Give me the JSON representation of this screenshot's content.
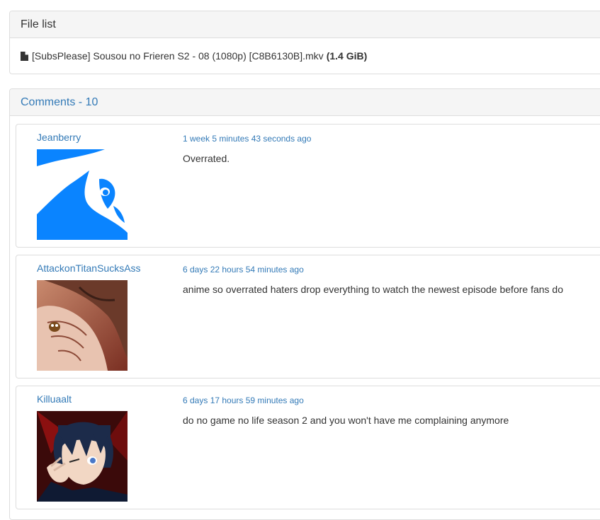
{
  "file_list": {
    "heading": "File list",
    "file": {
      "icon": "file-icon",
      "name": "[SubsPlease] Sousou no Frieren S2 - 08 (1080p) [C8B6130B].mkv",
      "size": "(1.4 GiB)"
    }
  },
  "comments": {
    "heading": "Comments - 10",
    "items": [
      {
        "username": "Jeanberry",
        "timestamp": "1 week 5 minutes 43 seconds ago",
        "text": "Overrated.",
        "avatar_icon": "blue-silhouette-avatar"
      },
      {
        "username": "AttackonTitanSucksAss",
        "timestamp": "6 days 22 hours 54 minutes ago",
        "text": "anime so overrated haters drop everything to watch the newest episode before fans do",
        "avatar_icon": "titan-face-avatar"
      },
      {
        "username": "Killuaalt",
        "timestamp": "6 days 17 hours 59 minutes ago",
        "text": "do no game no life season 2 and you won't have me complaining anymore",
        "avatar_icon": "anime-boy-avatar"
      }
    ]
  },
  "colors": {
    "link": "#337ab7",
    "text": "#333333",
    "panel_heading_bg": "#f5f5f5",
    "border": "#dddddd",
    "avatar_blue": "#0a84ff"
  }
}
